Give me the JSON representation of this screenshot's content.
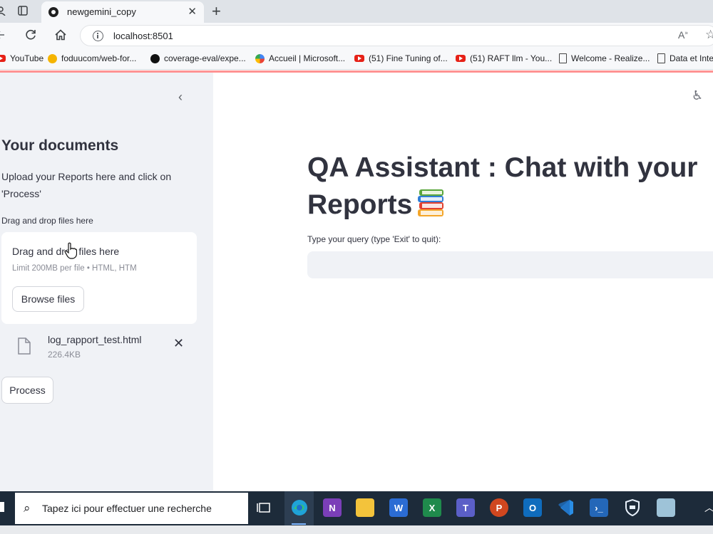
{
  "browser": {
    "tab_title": "newgemini_copy",
    "url": "localhost:8501",
    "bookmarks": [
      {
        "label": "YouTube",
        "icon": "youtube-icon"
      },
      {
        "label": "foduucom/web-for...",
        "icon": "hf-icon"
      },
      {
        "label": "coverage-eval/expe...",
        "icon": "github-icon"
      },
      {
        "label": "Accueil | Microsoft...",
        "icon": "microsoft-icon"
      },
      {
        "label": "(51) Fine Tuning of...",
        "icon": "youtube-icon"
      },
      {
        "label": "(51) RAFT llm - You...",
        "icon": "youtube-icon"
      },
      {
        "label": "Welcome - Realize...",
        "icon": "document-icon"
      },
      {
        "label": "Data et Inte",
        "icon": "document-icon"
      }
    ]
  },
  "sidebar": {
    "title": "Your documents",
    "description": "Upload your Reports here and click on 'Process'",
    "uploader_label": "Drag and drop files here",
    "dropzone_title": "Drag and drop files here",
    "dropzone_limit": "Limit 200MB per file • HTML, HTM",
    "browse_label": "Browse files",
    "file": {
      "name": "log_rapport_test.html",
      "size": "226.4KB"
    },
    "process_label": "Process"
  },
  "main": {
    "title": "QA Assistant : Chat with your Reports",
    "title_emoji": "books",
    "query_label": "Type your query (type 'Exit' to quit):",
    "query_value": ""
  },
  "taskbar": {
    "search_placeholder": "Tapez ici pour effectuer une recherche",
    "apps": [
      "task-view",
      "edge",
      "onenote",
      "file-explorer",
      "word",
      "excel",
      "teams",
      "powerpoint",
      "outlook",
      "vscode",
      "powershell",
      "defender",
      "notepad"
    ]
  },
  "colors": {
    "accent": "#ff4b4b",
    "sidebar_bg": "#f0f2f6",
    "text": "#31333f",
    "taskbar": "#1d2b3a"
  }
}
